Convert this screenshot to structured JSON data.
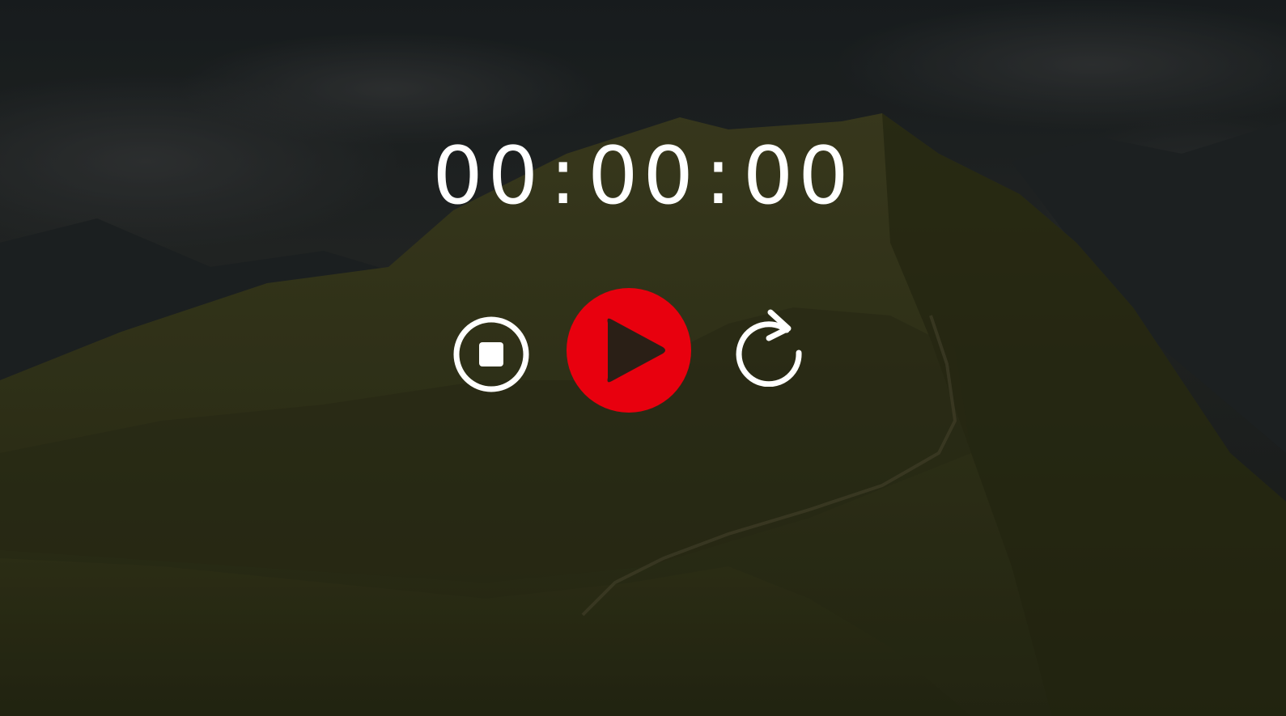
{
  "timer": {
    "hours": "00",
    "minutes": "00",
    "seconds": "00",
    "separator": ":"
  },
  "controls": {
    "stop": {
      "icon": "stop-icon"
    },
    "play": {
      "icon": "play-icon",
      "color": "#e8000e"
    },
    "reset": {
      "icon": "reset-icon"
    }
  },
  "theme": {
    "text_color": "#ffffff",
    "accent": "#e8000e"
  }
}
